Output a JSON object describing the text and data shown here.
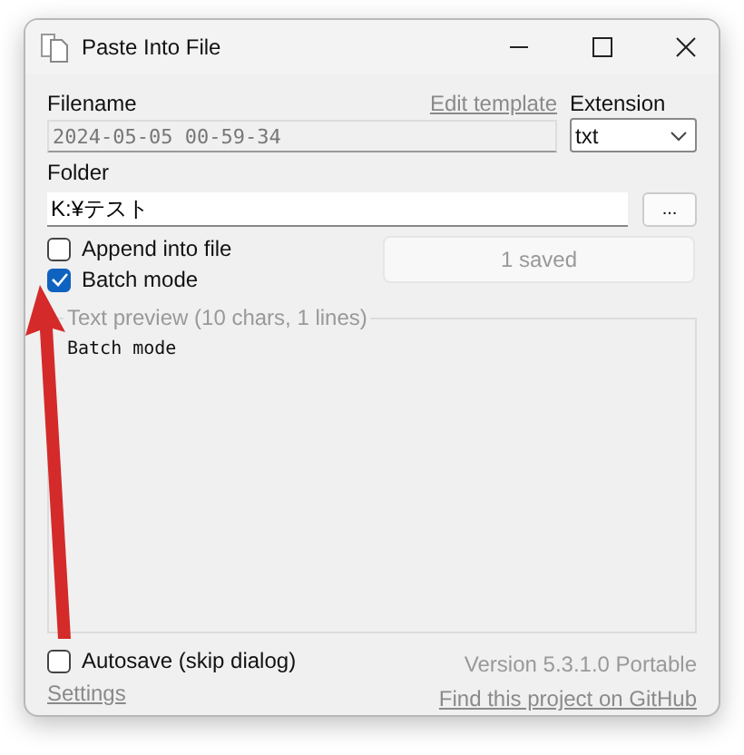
{
  "window": {
    "title": "Paste Into File"
  },
  "filename": {
    "label": "Filename",
    "value": "2024-05-05 00-59-34",
    "disabled": true
  },
  "edit_template": "Edit template",
  "extension": {
    "label": "Extension",
    "value": "txt"
  },
  "folder": {
    "label": "Folder",
    "value": "K:¥テスト",
    "browse": "..."
  },
  "options": [
    {
      "label": "Append into file",
      "checked": false
    },
    {
      "label": "Batch mode",
      "checked": true
    }
  ],
  "saved_button": {
    "label": "1 saved",
    "disabled": true
  },
  "preview": {
    "title": "Text preview (10 chars, 1 lines)",
    "text": "Batch mode"
  },
  "autosave": {
    "label": "Autosave (skip dialog)",
    "checked": false
  },
  "version": "Version 5.3.1.0 Portable",
  "settings_link": "Settings",
  "github_link": "Find this project on GitHub",
  "annotation": {
    "kind": "arrow"
  }
}
